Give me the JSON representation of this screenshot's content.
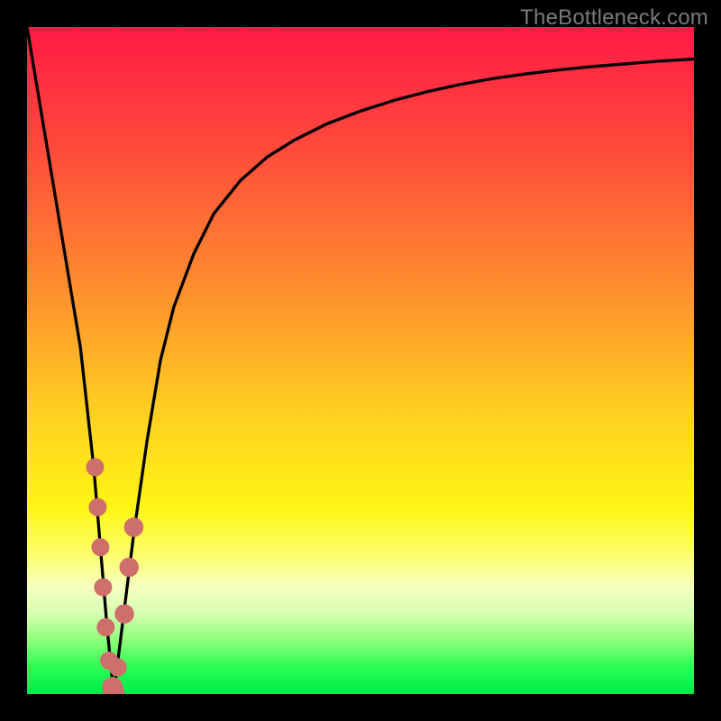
{
  "watermark": {
    "text": "TheBottleneck.com"
  },
  "colors": {
    "frame": "#000000",
    "curve": "#000000",
    "marker_fill": "#cf6f6b",
    "marker_stroke": "#cf6f6b",
    "gradient_stops": [
      {
        "pct": 0,
        "color": "#ff1a46"
      },
      {
        "pct": 18,
        "color": "#ff4a3b"
      },
      {
        "pct": 38,
        "color": "#ff8a2f"
      },
      {
        "pct": 58,
        "color": "#ffd021"
      },
      {
        "pct": 72,
        "color": "#fff514"
      },
      {
        "pct": 79,
        "color": "#fcff6a"
      },
      {
        "pct": 84,
        "color": "#f6ffc0"
      },
      {
        "pct": 88,
        "color": "#d6ffb0"
      },
      {
        "pct": 92,
        "color": "#8cff7a"
      },
      {
        "pct": 96,
        "color": "#2bff55"
      },
      {
        "pct": 100,
        "color": "#00e84a"
      }
    ]
  },
  "chart_data": {
    "type": "line",
    "title": "",
    "xlabel": "",
    "ylabel": "",
    "xlim": [
      0,
      100
    ],
    "ylim": [
      0,
      100
    ],
    "grid": false,
    "legend": false,
    "series": [
      {
        "name": "bottleneck-curve",
        "x": [
          0,
          2,
          4,
          6,
          8,
          10,
          11,
          12,
          13,
          14,
          16,
          18,
          20,
          22,
          25,
          28,
          32,
          36,
          40,
          45,
          50,
          55,
          60,
          65,
          70,
          75,
          80,
          85,
          90,
          95,
          100
        ],
        "y": [
          100,
          88,
          76,
          64,
          52,
          34,
          22,
          10,
          0,
          8,
          24,
          38,
          50,
          58,
          66,
          72,
          77,
          80.5,
          83,
          85.5,
          87.4,
          89,
          90.3,
          91.4,
          92.3,
          93,
          93.6,
          94.1,
          94.5,
          94.9,
          95.2
        ]
      }
    ],
    "markers": [
      {
        "x": 10.2,
        "y": 34,
        "r": 1.3
      },
      {
        "x": 10.6,
        "y": 28,
        "r": 1.3
      },
      {
        "x": 11.0,
        "y": 22,
        "r": 1.3
      },
      {
        "x": 11.4,
        "y": 16,
        "r": 1.3
      },
      {
        "x": 11.8,
        "y": 10,
        "r": 1.3
      },
      {
        "x": 12.3,
        "y": 5,
        "r": 1.3
      },
      {
        "x": 12.8,
        "y": 1,
        "r": 1.5
      },
      {
        "x": 13.0,
        "y": 0,
        "r": 1.6
      },
      {
        "x": 13.6,
        "y": 4,
        "r": 1.3
      },
      {
        "x": 14.6,
        "y": 12,
        "r": 1.4
      },
      {
        "x": 15.3,
        "y": 19,
        "r": 1.4
      },
      {
        "x": 16.0,
        "y": 25,
        "r": 1.4
      }
    ],
    "annotations": []
  }
}
